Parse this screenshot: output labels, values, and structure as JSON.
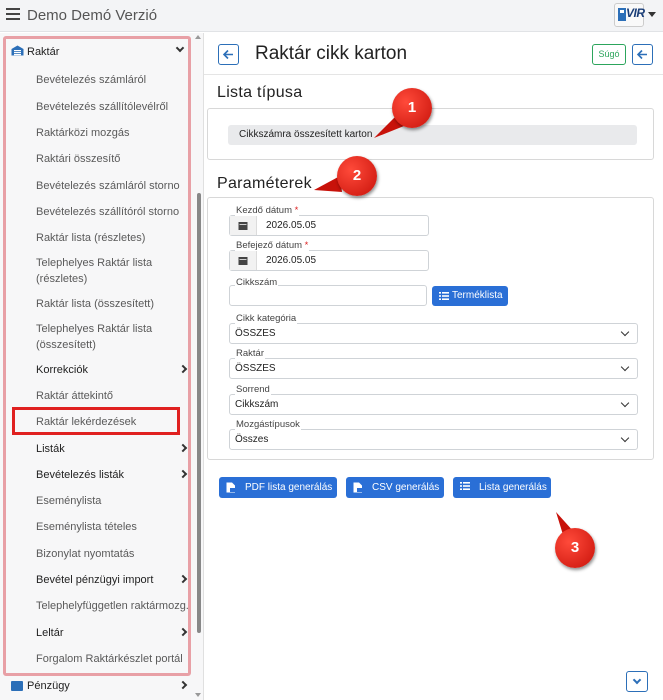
{
  "app": {
    "title": "Demo Demó Verzió",
    "logo_text": "VIR"
  },
  "sidebar": {
    "section": "Raktár",
    "items": [
      {
        "label": "Bevételezés számláról"
      },
      {
        "label": "Bevételezés szállítólevélről"
      },
      {
        "label": "Raktárközi mozgás"
      },
      {
        "label": "Raktári összesítő"
      },
      {
        "label": "Bevételezés számláról storno"
      },
      {
        "label": "Bevételezés szállítóról storno"
      },
      {
        "label": "Raktár lista (részletes)"
      },
      {
        "label": "Telephelyes Raktár lista (részletes)"
      },
      {
        "label": "Raktár lista (összesített)"
      },
      {
        "label": "Telephelyes Raktár lista (összesített)"
      },
      {
        "label": "Korrekciók"
      },
      {
        "label": "Raktár áttekintő"
      },
      {
        "label": "Raktár lekérdezések"
      },
      {
        "label": "Listák"
      },
      {
        "label": "Bevételezés listák"
      },
      {
        "label": "Eseménylista"
      },
      {
        "label": "Eseménylista tételes"
      },
      {
        "label": "Bizonylat nyomtatás"
      },
      {
        "label": "Bevétel pénzügyi import"
      },
      {
        "label": "Telephelyfüggetlen raktármozg."
      },
      {
        "label": "Leltár"
      },
      {
        "label": "Forgalom Raktárkészlet portál"
      }
    ],
    "next_section": "Pénzügy"
  },
  "header": {
    "title": "Raktár cikk karton",
    "help_label": "Súgó"
  },
  "list_type": {
    "title": "Lista típusa",
    "value": "Cikkszámra összesített karton"
  },
  "params": {
    "title": "Paraméterek",
    "start_date_label": "Kezdő dátum",
    "start_date": "2026.05.05",
    "end_date_label": "Befejező dátum",
    "end_date": "2026.05.05",
    "required_mark": "*",
    "sku_label": "Cikkszám",
    "sku_value": "",
    "product_list_button": "Terméklista",
    "category_label": "Cikk kategória",
    "category_value": "ÖSSZES",
    "warehouse_label": "Raktár",
    "warehouse_value": "ÖSSZES",
    "order_label": "Sorrend",
    "order_value": "Cikkszám",
    "movement_label": "Mozgástípusok",
    "movement_value": "Összes"
  },
  "actions": {
    "pdf": "PDF lista generálás",
    "csv": "CSV generálás",
    "list": "Lista generálás"
  },
  "annotations": {
    "one": "1",
    "two": "2",
    "three": "3"
  },
  "colors": {
    "primary": "#2a6fd6",
    "help": "#2ca55c",
    "highlight": "#e02020",
    "badge": "#d81c10"
  }
}
